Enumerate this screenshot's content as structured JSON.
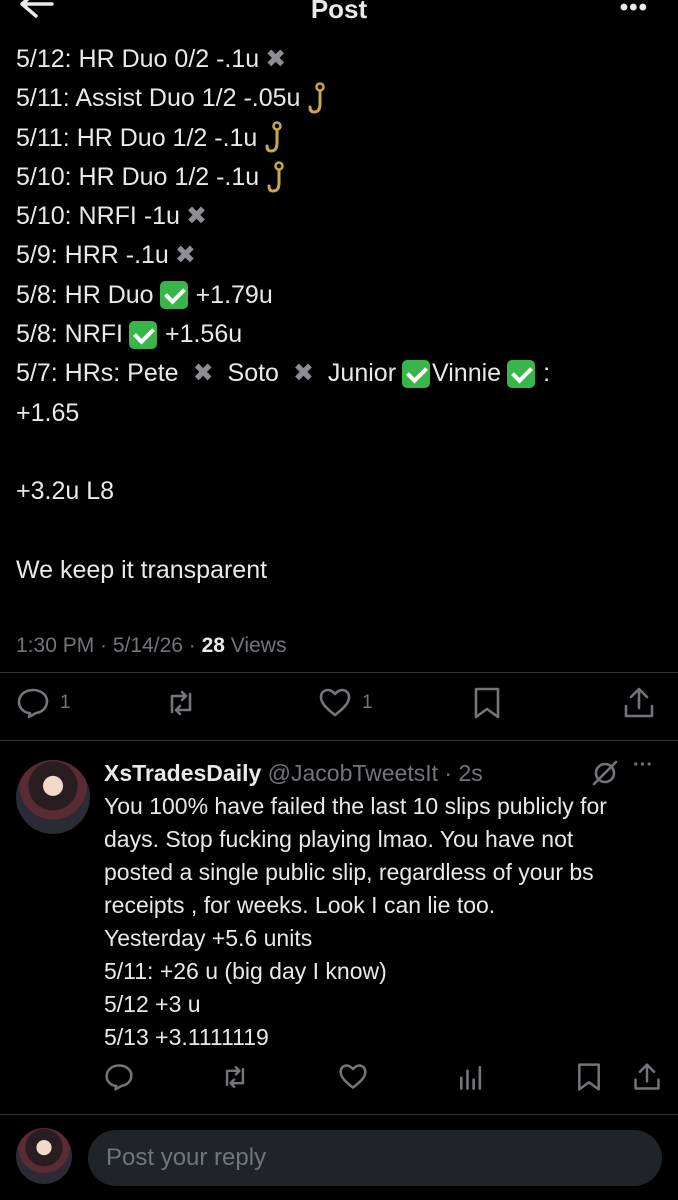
{
  "header": {
    "title": "Post",
    "more": "•••"
  },
  "post": {
    "lines": [
      {
        "text": "5/12: HR Duo 0/2 -.1u",
        "icon": "x"
      },
      {
        "text": "5/11: Assist Duo 1/2 -.05u",
        "icon": "hook"
      },
      {
        "text": "5/11: HR Duo 1/2 -.1u",
        "icon": "hook"
      },
      {
        "text": "5/10: HR Duo 1/2 -.1u",
        "icon": "hook"
      },
      {
        "text": "5/10: NRFI -1u",
        "icon": "x"
      },
      {
        "text": "5/9: HRR -.1u",
        "icon": "x"
      }
    ],
    "l7a": "5/8: HR Duo",
    "l7b": "+1.79u",
    "l8a": "5/8: NRFI",
    "l8b": "+1.56u",
    "l9a": "5/7: HRs: Pete",
    "l9b": "Soto",
    "l9c": "Junior",
    "l9d": "Vinnie",
    "l9e": ":",
    "l10": "+1.65",
    "summary": "+3.2u L8",
    "closing": "We keep it transparent"
  },
  "meta": {
    "time": "1:30 PM · 5/14/26 · ",
    "views_count": "28",
    "views_label": " Views"
  },
  "actions": {
    "replies": "1",
    "likes": "1"
  },
  "reply": {
    "name": "XsTradesDaily",
    "handle": "@JacobTweetsIt · 2s",
    "more": "···",
    "lines": [
      "You 100% have failed the last 10 slips publicly for",
      "days. Stop fucking playing lmao.  You have not",
      "posted a single public slip, regardless of your bs",
      "receipts , for weeks.   Look I can lie too.",
      "Yesterday +5.6 units",
      "5/11: +26 u (big day I know)",
      "5/12 +3 u",
      "5/13 +3.1111119"
    ]
  },
  "composer": {
    "placeholder": "Post your reply"
  },
  "colors": {
    "background": "#000000",
    "text": "#e7e9ea",
    "muted": "#71767b",
    "check": "#38b64a",
    "divider": "#2f3336"
  }
}
